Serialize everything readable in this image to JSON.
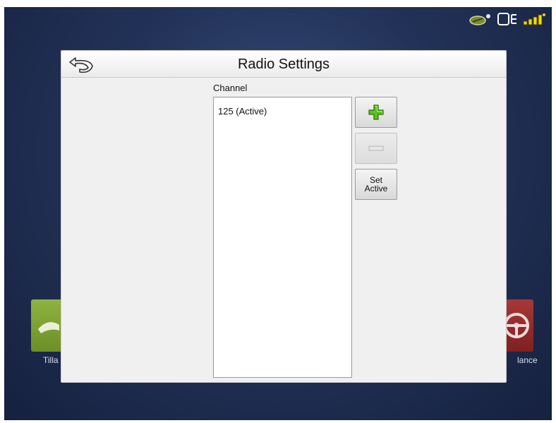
{
  "status_bar": {
    "icons": [
      "field-signal-icon",
      "display-module-icon",
      "gps-signal-icon"
    ]
  },
  "background": {
    "left_tile_label": "Tilla",
    "right_tile_label": "lance"
  },
  "dialog": {
    "title": "Radio Settings",
    "back_icon": "back-arrow-icon",
    "channel_label": "Channel",
    "channels": [
      "125 (Active)"
    ],
    "add_icon": "plus-icon",
    "remove_icon": "minus-icon",
    "set_active_label": "Set\nActive"
  },
  "colors": {
    "add_icon_green": "#5cc21f",
    "background_blue": "#223258"
  }
}
